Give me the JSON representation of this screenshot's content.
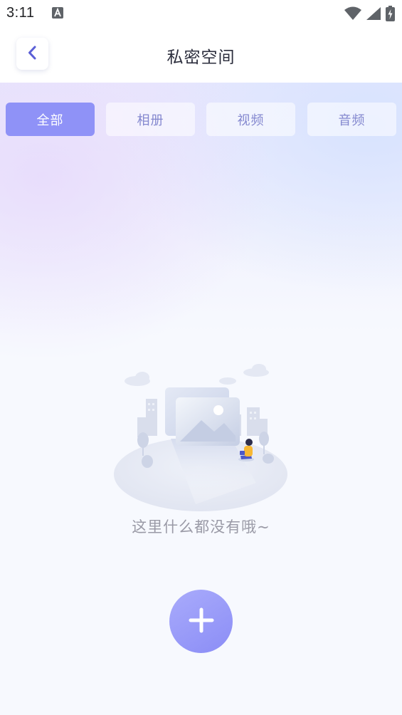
{
  "status_bar": {
    "time": "3:11"
  },
  "header": {
    "title": "私密空间"
  },
  "tabs": [
    {
      "label": "全部",
      "active": true
    },
    {
      "label": "相册",
      "active": false
    },
    {
      "label": "视频",
      "active": false
    },
    {
      "label": "音频",
      "active": false
    }
  ],
  "empty_state": {
    "message": "这里什么都没有哦~"
  },
  "colors": {
    "accent": "#8f92f7",
    "tab_text": "#8488cf",
    "title_text": "#2b2d3c",
    "empty_text": "#9a9aa6"
  },
  "icons": {
    "back": "chevron-left-icon",
    "add": "plus-icon",
    "status": [
      "keyboard-a-icon",
      "wifi-icon",
      "signal-icon",
      "battery-charging-icon"
    ]
  }
}
